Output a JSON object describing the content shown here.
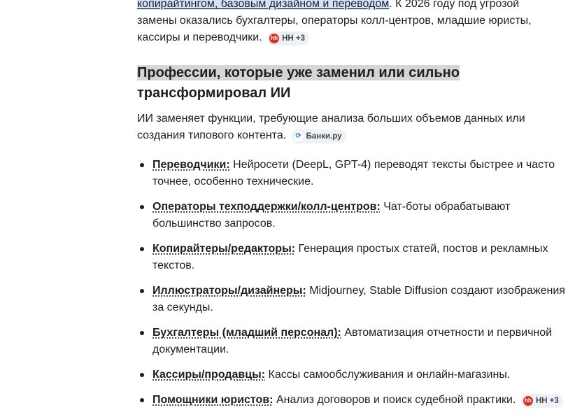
{
  "intro": {
    "highlighted": "копирайтингом, базовым дизайном и переводом",
    "after_highlight": ". К 2026 году под угрозой",
    "line2": "замены оказались бухгалтеры, операторы колл-центров, младшие юристы,",
    "line3": "кассиры и переводчики.",
    "chip": {
      "label": "HH +3",
      "icon": "hh-logo-icon"
    }
  },
  "section": {
    "heading_line1": "Профессии, которые уже заменил или сильно",
    "heading_line2": "трансформировал ИИ",
    "lead_line1": "ИИ заменяет функции, требующие анализа больших объемов данных или",
    "lead_line2": "создания типового контента.",
    "lead_chip": {
      "label": "Банки.ру",
      "icon": "banki-logo-icon"
    }
  },
  "items": [
    {
      "term": "Переводчики:",
      "text": "Нейросети (DeepL, GPT-4) переводят тексты быстрее и часто точнее, особенно технические."
    },
    {
      "term": "Операторы техподдержки/колл-центров:",
      "text": "Чат-боты обрабатывают большинство запросов."
    },
    {
      "term": "Копирайтеры/редакторы:",
      "text": "Генерация простых статей, постов и рекламных текстов."
    },
    {
      "term": "Иллюстраторы/дизайнеры:",
      "text": "Midjourney, Stable Diffusion создают изображения за секунды."
    },
    {
      "term": "Бухгалтеры (младший персонал):",
      "text": "Автоматизация отчетности и первичной документации."
    },
    {
      "term": "Кассиры/продавцы:",
      "text": "Кассы самообслуживания и онлайн-магазины."
    },
    {
      "term": "Помощники юристов:",
      "text": "Анализ договоров и поиск судебной практики.",
      "chip": "HH +3"
    }
  ]
}
